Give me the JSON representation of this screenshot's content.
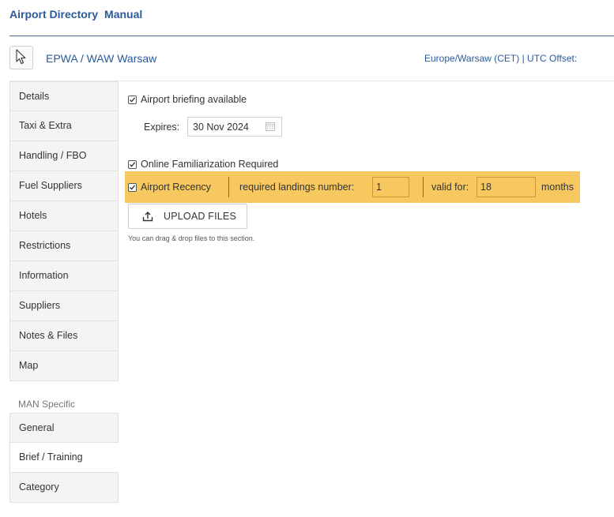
{
  "header": {
    "title": "Airport Directory",
    "subtitle": "Manual"
  },
  "airport": {
    "icon": "cursor-icon",
    "name": "EPWA / WAW Warsaw",
    "timezone": "Europe/Warsaw (CET) | UTC Offset:"
  },
  "sidebar": {
    "items": [
      {
        "label": "Details"
      },
      {
        "label": "Taxi & Extra"
      },
      {
        "label": "Handling / FBO"
      },
      {
        "label": "Fuel Suppliers"
      },
      {
        "label": "Hotels"
      },
      {
        "label": "Restrictions"
      },
      {
        "label": "Information"
      },
      {
        "label": "Suppliers"
      },
      {
        "label": "Notes & Files"
      },
      {
        "label": "Map"
      }
    ],
    "group_label": "MAN Specific",
    "group_items": [
      {
        "label": "General"
      },
      {
        "label": "Brief / Training",
        "active": true
      },
      {
        "label": "Category"
      }
    ]
  },
  "main": {
    "briefing": {
      "label": "Airport briefing available",
      "checked": true
    },
    "expires": {
      "label": "Expires:",
      "value": "30 Nov 2024"
    },
    "familiarization": {
      "label": "Online Familiarization Required",
      "checked": true
    },
    "recency": {
      "label": "Airport Recency",
      "checked": true,
      "landings_label": "required landings number:",
      "landings_value": "1",
      "valid_label": "valid for:",
      "valid_value": "18",
      "months_label": "months"
    },
    "upload": {
      "label": "UPLOAD FILES",
      "icon": "upload-icon"
    },
    "hint": "You can drag & drop files to this section."
  },
  "colors": {
    "accent": "#2a5a9a",
    "highlight": "#f6c85f"
  }
}
